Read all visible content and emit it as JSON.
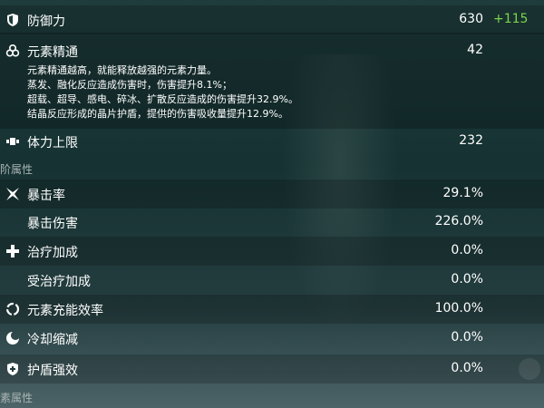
{
  "stats": {
    "defense": {
      "label": "防御力",
      "value": "630",
      "bonus": "+115"
    },
    "em": {
      "label": "元素精通",
      "value": "42",
      "desc": [
        "元素精通越高，就能释放越强的元素力量。",
        "蒸发、融化反应造成伤害时，伤害提升8.1%；",
        "超载、超导、感电、碎冰、扩散反应造成的伤害提升32.9%。",
        "结晶反应形成的晶片护盾，提供的伤害吸收量提升12.9%。"
      ]
    },
    "stamina": {
      "label": "体力上限",
      "value": "232"
    }
  },
  "sections": {
    "advanced": "进阶属性",
    "elemental": "元素属性"
  },
  "advanced": {
    "crit_rate": {
      "label": "暴击率",
      "value": "29.1%"
    },
    "crit_dmg": {
      "label": "暴击伤害",
      "value": "226.0%"
    },
    "healing": {
      "label": "治疗加成",
      "value": "0.0%"
    },
    "incoming_healing": {
      "label": "受治疗加成",
      "value": "0.0%"
    },
    "energy_recharge": {
      "label": "元素充能效率",
      "value": "100.0%"
    },
    "cd_reduction": {
      "label": "冷却缩减",
      "value": "0.0%"
    },
    "shield_strength": {
      "label": "护盾强效",
      "value": "0.0%"
    }
  },
  "icons": [
    "shield-icon",
    "em-icon",
    "stamina-icon",
    "crit-icon",
    "healing-icon",
    "energy-icon",
    "cooldown-icon",
    "shield-strength-icon"
  ]
}
